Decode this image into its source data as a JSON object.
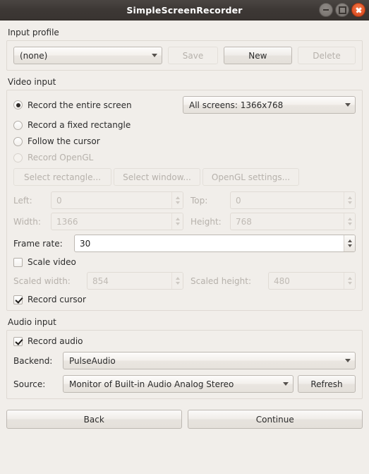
{
  "window": {
    "title": "SimpleScreenRecorder",
    "controls": [
      {
        "name": "minimize-button",
        "icon": "minimize-icon"
      },
      {
        "name": "maximize-button",
        "icon": "maximize-icon"
      },
      {
        "name": "close-button",
        "icon": "close-icon"
      }
    ],
    "titlebar_color": "#3d3835",
    "close_color": "#e2562a",
    "background_color": "#f1eeea"
  },
  "input_profile": {
    "section_label": "Input profile",
    "profile_value": "(none)",
    "save_label": "Save",
    "new_label": "New",
    "delete_label": "Delete"
  },
  "video_input": {
    "section_label": "Video input",
    "options": [
      {
        "label": "Record the entire screen",
        "selected": true,
        "enabled": true
      },
      {
        "label": "Record a fixed rectangle",
        "selected": false,
        "enabled": true
      },
      {
        "label": "Follow the cursor",
        "selected": false,
        "enabled": true
      },
      {
        "label": "Record OpenGL",
        "selected": false,
        "enabled": false
      }
    ],
    "screen_combo_value": "All screens: 1366x768",
    "select_rectangle_label": "Select rectangle...",
    "select_window_label": "Select window...",
    "opengl_settings_label": "OpenGL settings...",
    "left_label": "Left:",
    "left_value": "0",
    "top_label": "Top:",
    "top_value": "0",
    "width_label": "Width:",
    "width_value": "1366",
    "height_label": "Height:",
    "height_value": "768",
    "frame_rate_label": "Frame rate:",
    "frame_rate_value": "30",
    "scale_video_label": "Scale video",
    "scale_video_checked": false,
    "scaled_width_label": "Scaled width:",
    "scaled_width_value": "854",
    "scaled_height_label": "Scaled height:",
    "scaled_height_value": "480",
    "record_cursor_label": "Record cursor",
    "record_cursor_checked": true
  },
  "audio_input": {
    "section_label": "Audio input",
    "record_audio_label": "Record audio",
    "record_audio_checked": true,
    "backend_label": "Backend:",
    "backend_value": "PulseAudio",
    "source_label": "Source:",
    "source_value": "Monitor of Built-in Audio Analog Stereo",
    "refresh_label": "Refresh"
  },
  "footer": {
    "back_label": "Back",
    "continue_label": "Continue"
  }
}
